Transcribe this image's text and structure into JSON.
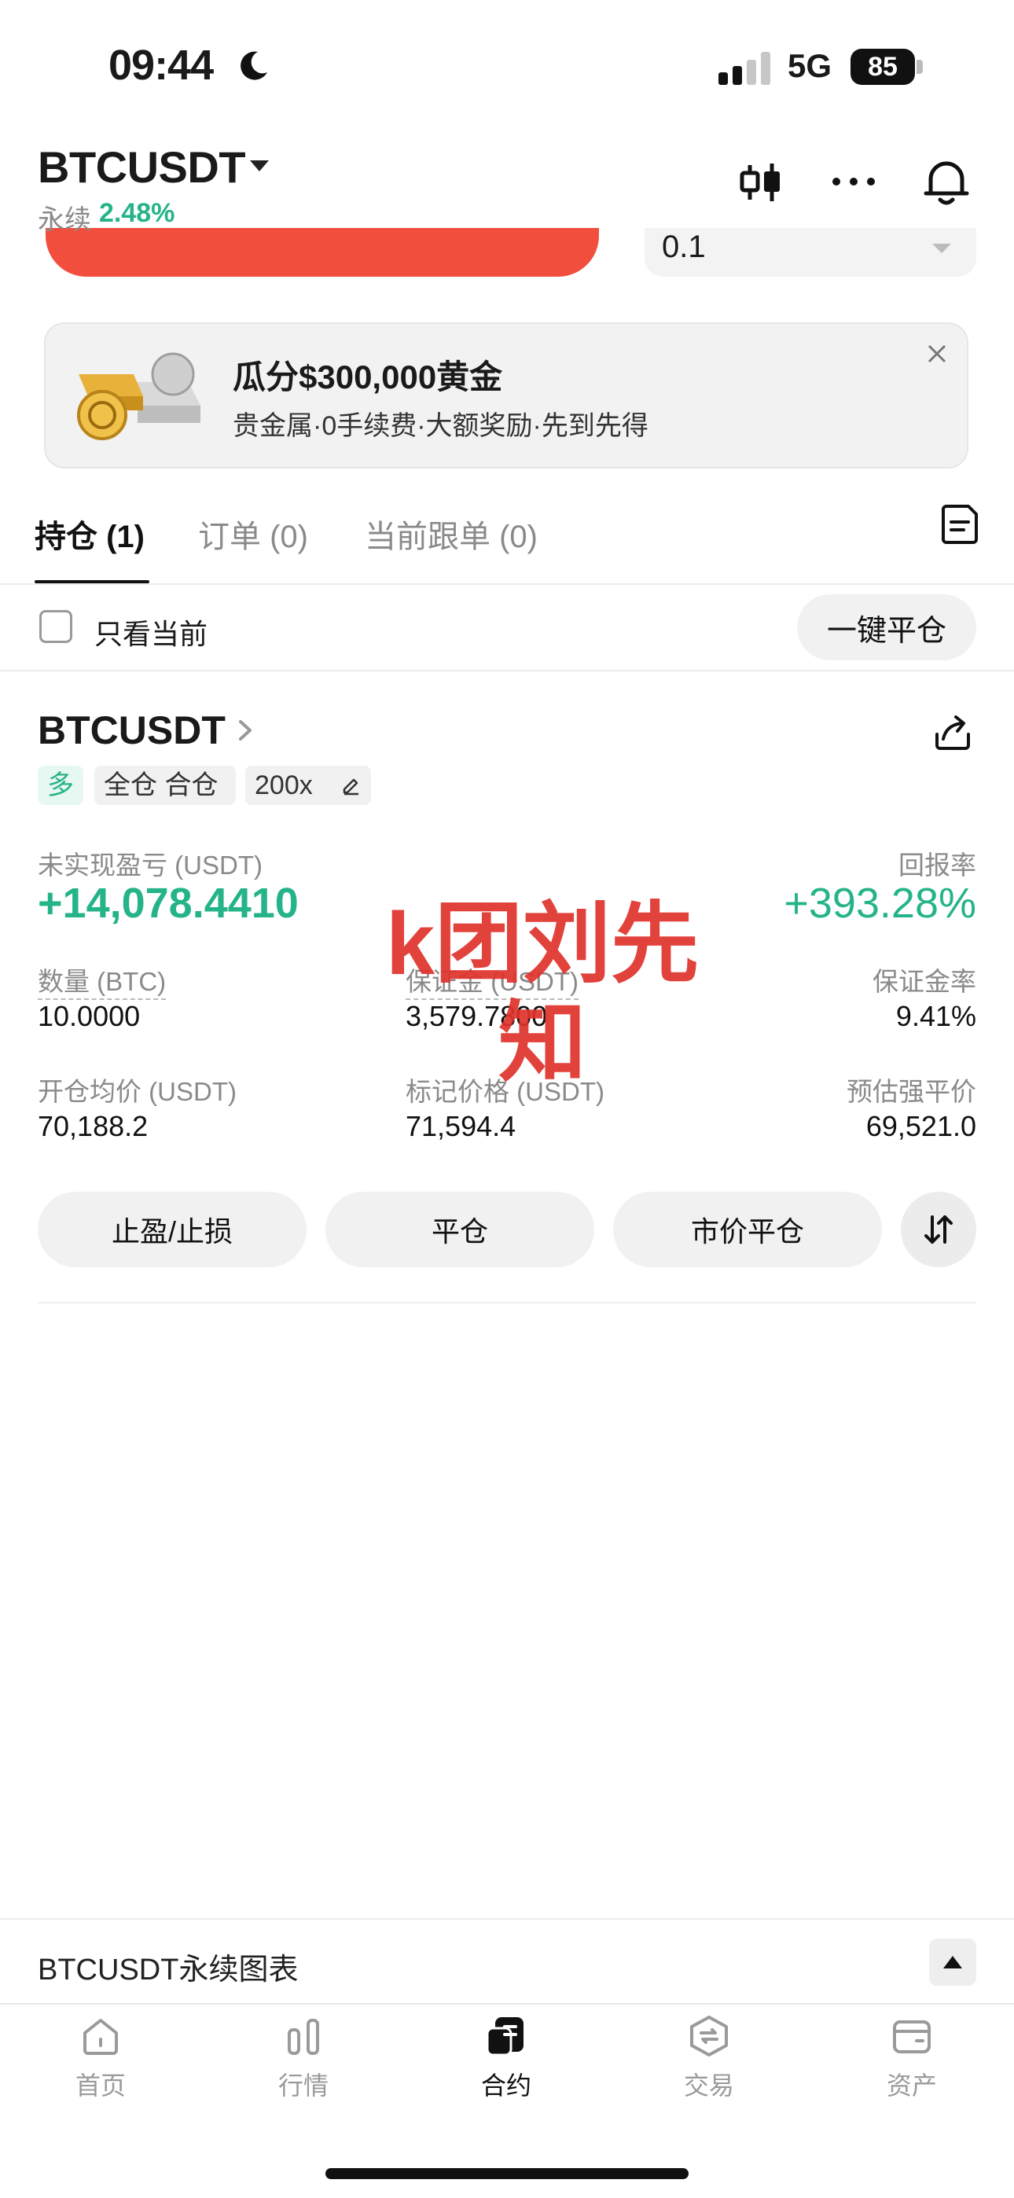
{
  "status_bar": {
    "time": "09:44",
    "network": "5G",
    "battery": "85"
  },
  "header": {
    "pair": "BTCUSDT",
    "contract_type": "永续",
    "change": "2.48%"
  },
  "order_form": {
    "quantity_value": "0.1"
  },
  "banner": {
    "title": "瓜分$300,000黄金",
    "subtitle": "贵金属·0手续费·大额奖励·先到先得"
  },
  "tabs": [
    {
      "label": "持仓 (1)",
      "active": true
    },
    {
      "label": "订单 (0)",
      "active": false
    },
    {
      "label": "当前跟单 (0)",
      "active": false
    }
  ],
  "filter": {
    "only_current_label": "只看当前",
    "close_all_label": "一键平仓"
  },
  "position": {
    "symbol": "BTCUSDT",
    "side": "多",
    "margin_mode": "全仓 合仓",
    "leverage": "200x",
    "unrealized_pnl_label": "未实现盈亏 (USDT)",
    "unrealized_pnl": "+14,078.4410",
    "roe_label": "回报率",
    "roe": "+393.28%",
    "qty_label": "数量 (BTC)",
    "qty": "10.0000",
    "margin_label": "保证金 (USDT)",
    "margin": "3,579.7800",
    "margin_ratio_label": "保证金率",
    "margin_ratio": "9.41%",
    "entry_label": "开仓均价 (USDT)",
    "entry": "70,188.2",
    "mark_label": "标记价格 (USDT)",
    "mark": "71,594.4",
    "liq_label": "预估强平价",
    "liq": "69,521.0",
    "actions": {
      "tp_sl": "止盈/止损",
      "close": "平仓",
      "market_close": "市价平仓"
    }
  },
  "watermark": "k团刘先知",
  "chart_bar": {
    "label": "BTCUSDT永续图表"
  },
  "bottom_nav": [
    {
      "label": "首页",
      "icon": "home-icon",
      "active": false
    },
    {
      "label": "行情",
      "icon": "market-icon",
      "active": false
    },
    {
      "label": "合约",
      "icon": "futures-icon",
      "active": true
    },
    {
      "label": "交易",
      "icon": "trade-icon",
      "active": false
    },
    {
      "label": "资产",
      "icon": "wallet-icon",
      "active": false
    }
  ],
  "colors": {
    "green": "#25b38a",
    "red": "#f24e3d",
    "watermark": "#e0322c"
  }
}
